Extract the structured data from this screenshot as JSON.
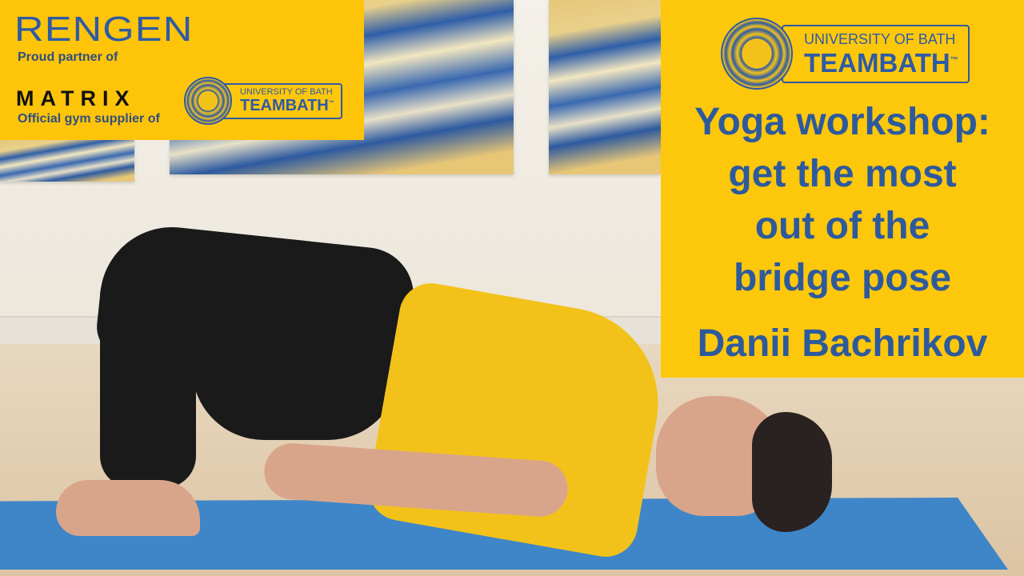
{
  "top_left_banner": {
    "brand": "RENGEN",
    "partner_text": "Proud partner of",
    "supplier_brand": "MATRIX",
    "supplier_text": "Official gym supplier of",
    "team_logo": {
      "line1": "UNIVERSITY OF BATH",
      "line2": "TEAMBATH",
      "tm": "™"
    }
  },
  "right_panel": {
    "team_logo": {
      "line1": "UNIVERSITY OF BATH",
      "line2": "TEAMBATH",
      "tm": "™"
    },
    "title_lines": [
      "Yoga workshop:",
      "get the most",
      "out of the",
      "bridge pose"
    ],
    "presenter": "Danii Bachrikov"
  },
  "colors": {
    "panel_yellow": "#fdc70c",
    "text_blue": "#2d5a9c",
    "mat_blue": "#3f86c8"
  }
}
